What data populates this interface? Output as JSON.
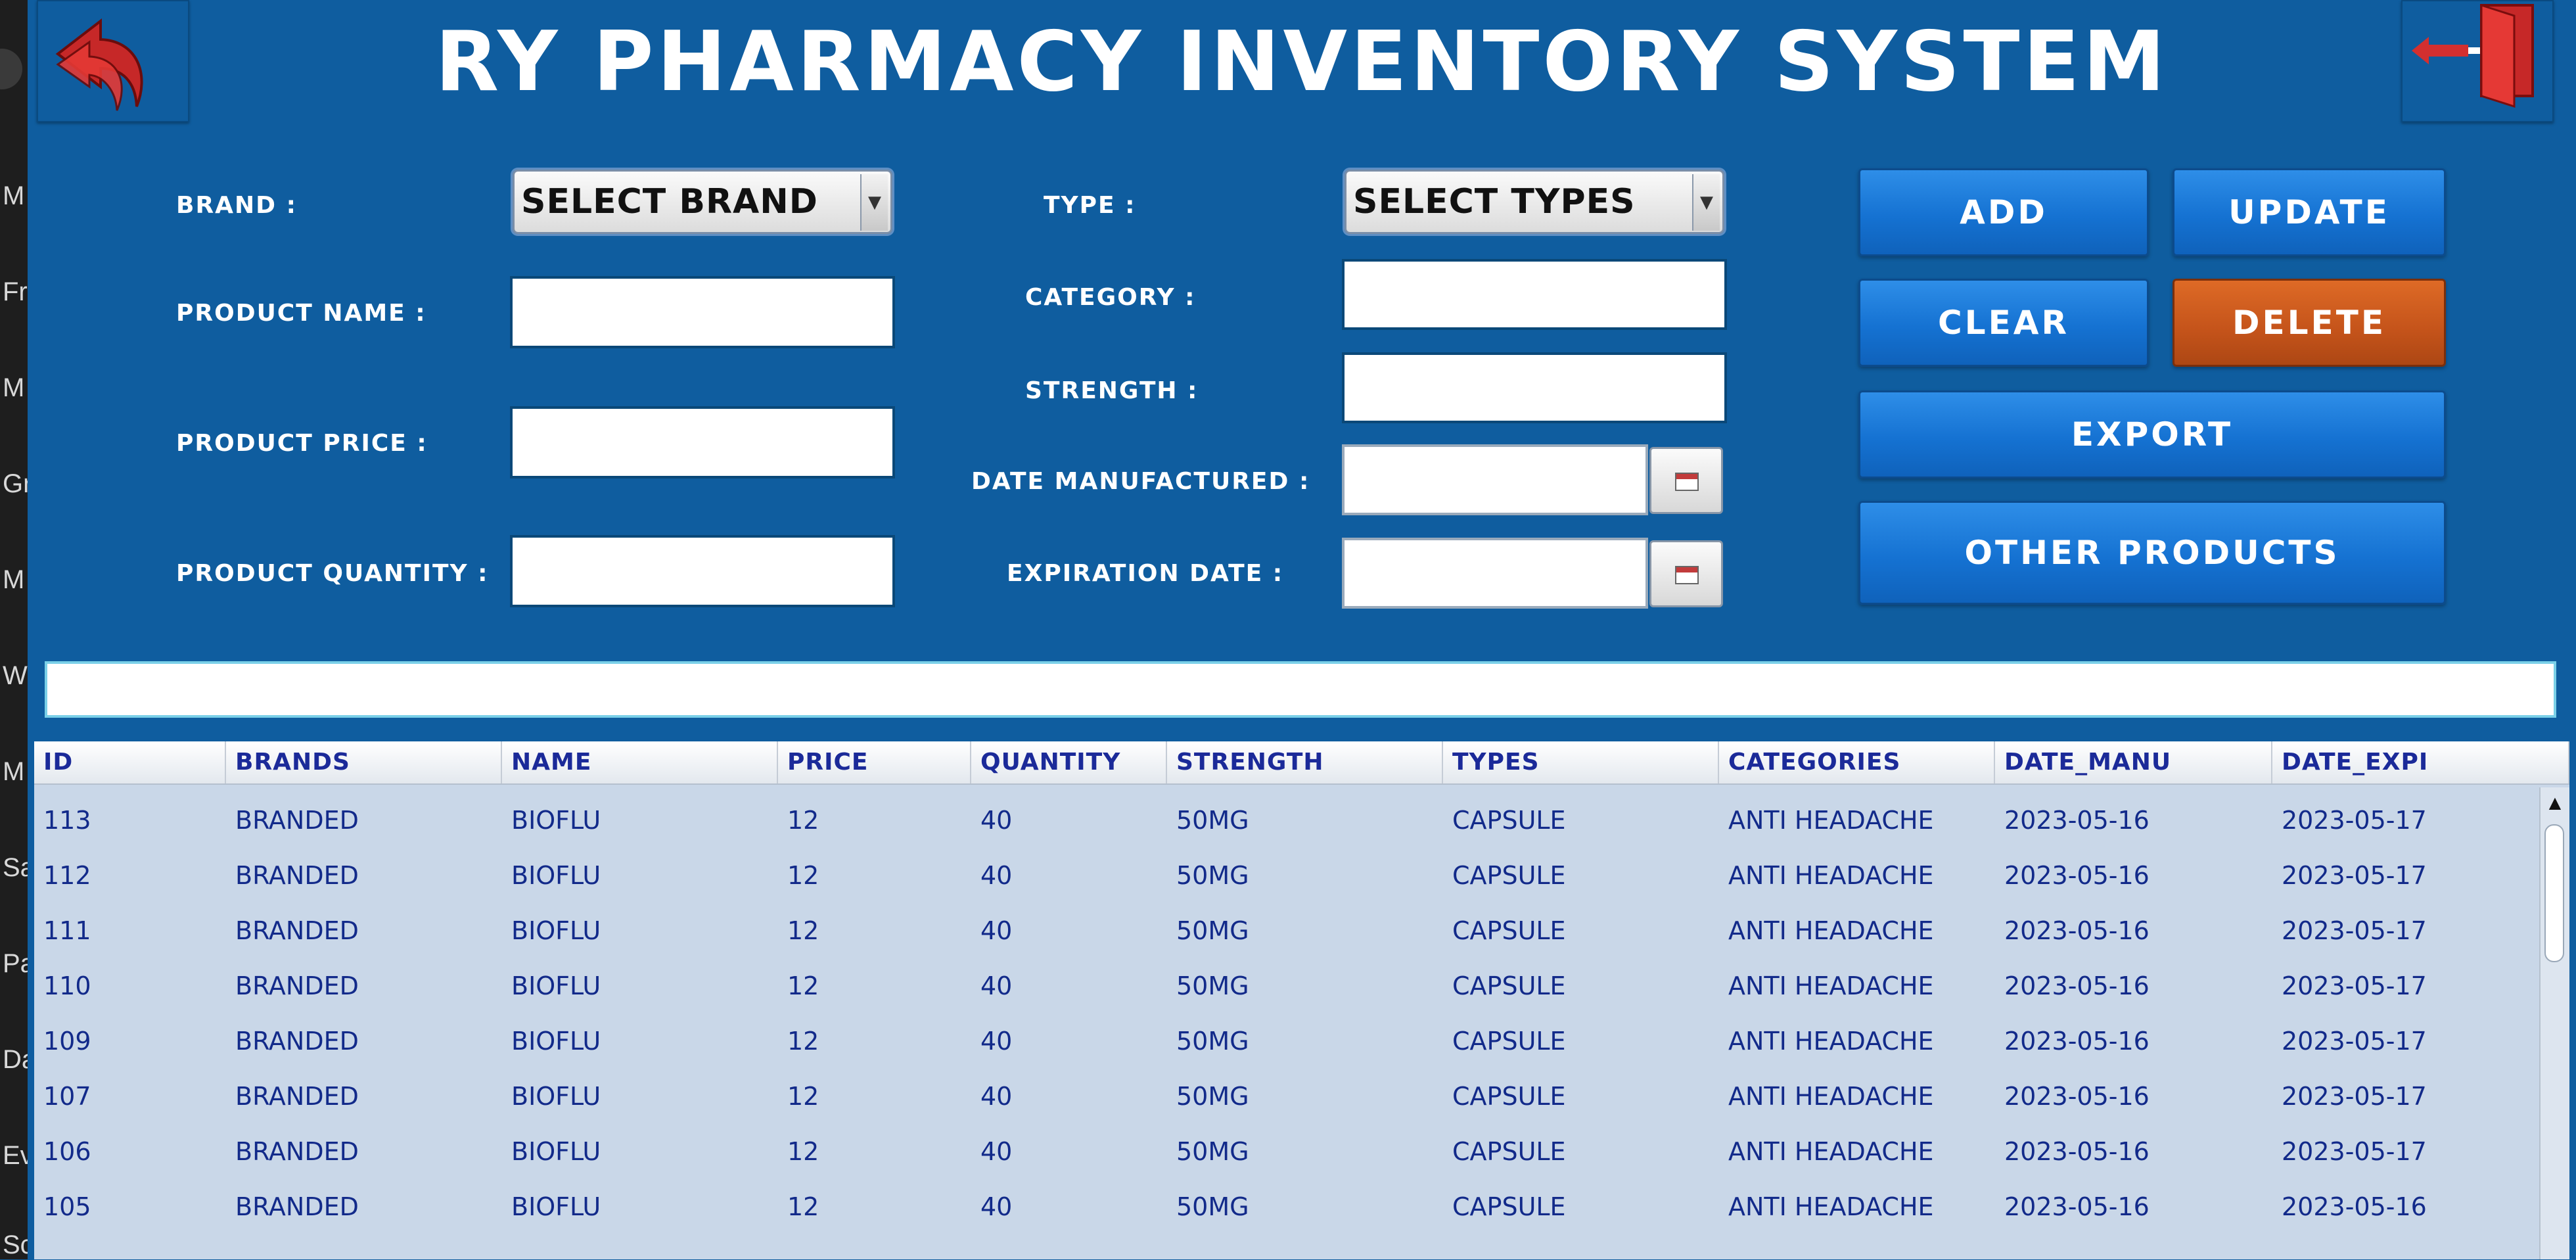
{
  "background_window": {
    "letters": [
      "M",
      "Fr",
      "M",
      "Gr",
      "M",
      "W",
      "M",
      "Sa",
      "Pa",
      "Da",
      "Ev",
      "Sc"
    ]
  },
  "header": {
    "title": "RY PHARMACY INVENTORY SYSTEM"
  },
  "form": {
    "brand_label": "BRAND :",
    "brand_value": "SELECT BRAND",
    "product_name_label": "PRODUCT NAME  :",
    "product_price_label": "PRODUCT PRICE :",
    "product_quantity_label": "PRODUCT QUANTITY :",
    "type_label": "TYPE :",
    "type_value": "SELECT TYPES",
    "category_label": "CATEGORY :",
    "strength_label": "STRENGTH :",
    "date_manufactured_label": "DATE MANUFACTURED :",
    "expiration_date_label": "EXPIRATION DATE :"
  },
  "buttons": {
    "add": "ADD",
    "update": "UPDATE",
    "clear": "CLEAR",
    "delete": "DELETE",
    "export": "EXPORT",
    "other_products": "OTHER PRODUCTS"
  },
  "table": {
    "columns": [
      "ID",
      "BRANDS",
      "NAME",
      "PRICE",
      "QUANTITY",
      "STRENGTH",
      "TYPES",
      "CATEGORIES",
      "DATE_MANU",
      "DATE_EXPI"
    ],
    "rows": [
      [
        "113",
        "BRANDED",
        "BIOFLU",
        "12",
        "40",
        "50MG",
        "CAPSULE",
        "ANTI HEADACHE",
        "2023-05-16",
        "2023-05-17"
      ],
      [
        "112",
        "BRANDED",
        "BIOFLU",
        "12",
        "40",
        "50MG",
        "CAPSULE",
        "ANTI HEADACHE",
        "2023-05-16",
        "2023-05-17"
      ],
      [
        "111",
        "BRANDED",
        "BIOFLU",
        "12",
        "40",
        "50MG",
        "CAPSULE",
        "ANTI HEADACHE",
        "2023-05-16",
        "2023-05-17"
      ],
      [
        "110",
        "BRANDED",
        "BIOFLU",
        "12",
        "40",
        "50MG",
        "CAPSULE",
        "ANTI HEADACHE",
        "2023-05-16",
        "2023-05-17"
      ],
      [
        "109",
        "BRANDED",
        "BIOFLU",
        "12",
        "40",
        "50MG",
        "CAPSULE",
        "ANTI HEADACHE",
        "2023-05-16",
        "2023-05-17"
      ],
      [
        "107",
        "BRANDED",
        "BIOFLU",
        "12",
        "40",
        "50MG",
        "CAPSULE",
        "ANTI HEADACHE",
        "2023-05-16",
        "2023-05-17"
      ],
      [
        "106",
        "BRANDED",
        "BIOFLU",
        "12",
        "40",
        "50MG",
        "CAPSULE",
        "ANTI HEADACHE",
        "2023-05-16",
        "2023-05-17"
      ],
      [
        "105",
        "BRANDED",
        "BIOFLU",
        "12",
        "40",
        "50MG",
        "CAPSULE",
        "ANTI HEADACHE",
        "2023-05-16",
        "2023-05-16"
      ]
    ]
  },
  "colors": {
    "background": "#0f5d9f",
    "button_blue": "#1572d2",
    "button_delete": "#c4531a",
    "table_background": "#c9d7e8",
    "table_text": "#122a8a"
  },
  "icons": {
    "back": "back-arrow-icon",
    "exit": "exit-door-icon",
    "calendar": "calendar-icon",
    "dropdown": "chevron-down-icon"
  }
}
